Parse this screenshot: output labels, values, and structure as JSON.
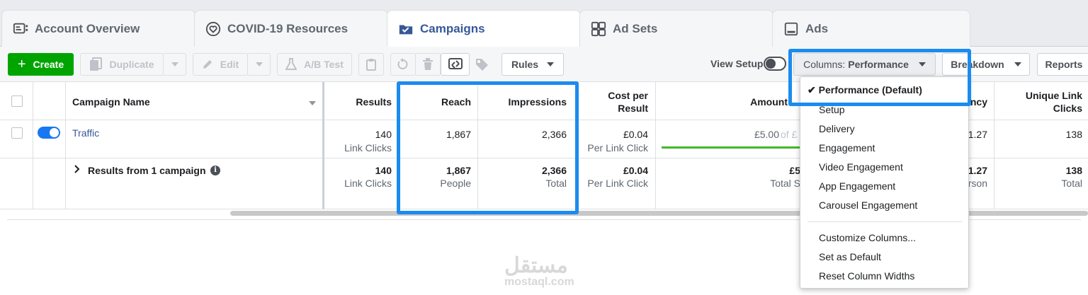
{
  "tabs": [
    {
      "label": "Account Overview",
      "icon": "account-overview-icon"
    },
    {
      "label": "COVID-19 Resources",
      "icon": "heart-icon"
    },
    {
      "label": "Campaigns",
      "icon": "folder-check-icon",
      "active": true
    },
    {
      "label": "Ad Sets",
      "icon": "grid-icon"
    },
    {
      "label": "Ads",
      "icon": "ad-icon"
    }
  ],
  "toolbar": {
    "create_label": "Create",
    "duplicate_label": "Duplicate",
    "edit_label": "Edit",
    "ab_test_label": "A/B Test",
    "rules_label": "Rules",
    "view_setup_label": "View Setup",
    "columns_prefix": "Columns:",
    "columns_value": "Performance",
    "breakdown_label": "Breakdown",
    "reports_label": "Reports"
  },
  "table": {
    "headers": {
      "name": "Campaign Name",
      "results": "Results",
      "reach": "Reach",
      "impressions": "Impressions",
      "cost_line1": "Cost per",
      "cost_line2": "Result",
      "amount": "Amount",
      "frequency": "ncy",
      "unique_line1": "Unique Link",
      "unique_line2": "Clicks"
    },
    "row": {
      "name": "Traffic",
      "results": "140",
      "results_sub": "Link Clicks",
      "reach": "1,867",
      "impressions": "2,366",
      "cost": "£0.04",
      "cost_sub": "Per Link Click",
      "amount": "£5.00",
      "amount_suffix": "of £",
      "frequency": "1.27",
      "unique": "138"
    },
    "summary": {
      "label": "Results from 1 campaign",
      "results": "140",
      "results_sub": "Link Clicks",
      "reach": "1,867",
      "reach_sub": "People",
      "impressions": "2,366",
      "impressions_sub": "Total",
      "cost": "£0.04",
      "cost_sub": "Per Link Click",
      "amount": "£5",
      "amount_sub": "Total S",
      "frequency": "1.27",
      "frequency_sub": "rson",
      "unique": "138",
      "unique_sub": "Total"
    }
  },
  "dropdown": {
    "selected": "Performance (Default)",
    "items": [
      "Setup",
      "Delivery",
      "Engagement",
      "Video Engagement",
      "App Engagement",
      "Carousel Engagement"
    ],
    "actions": [
      "Customize Columns...",
      "Set as Default",
      "Reset Column Widths"
    ]
  },
  "watermark": {
    "arabic": "مستقل",
    "latin": "mostaql.com"
  },
  "colors": {
    "accent": "#1877f2",
    "highlight": "#1a8cf0",
    "create": "#00a400",
    "link": "#365899"
  }
}
